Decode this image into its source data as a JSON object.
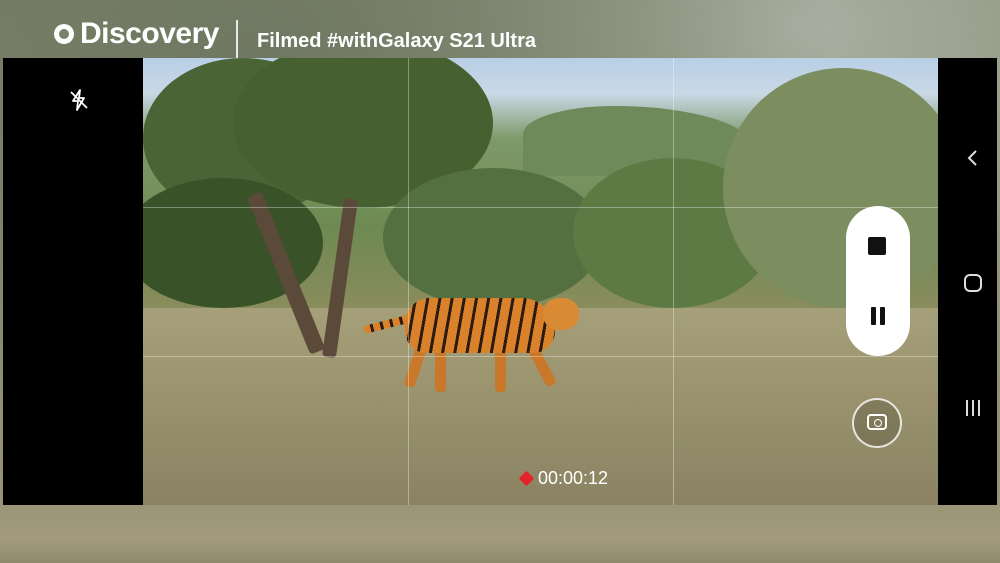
{
  "header": {
    "brand": "Discovery",
    "tagline": "Filmed #withGalaxy S21 Ultra"
  },
  "camera": {
    "flash_icon": "flash-off-icon",
    "recording_time": "00:00:12",
    "stop_icon": "stop-icon",
    "pause_icon": "pause-icon",
    "capture_icon": "camera-capture-icon"
  },
  "nav_bar": {
    "back_icon": "back-icon",
    "home_icon": "home-icon",
    "recents_icon": "recents-icon"
  },
  "colors": {
    "record_dot": "#e3242b",
    "pill_background": "#ffffff",
    "frame": "#000000"
  }
}
